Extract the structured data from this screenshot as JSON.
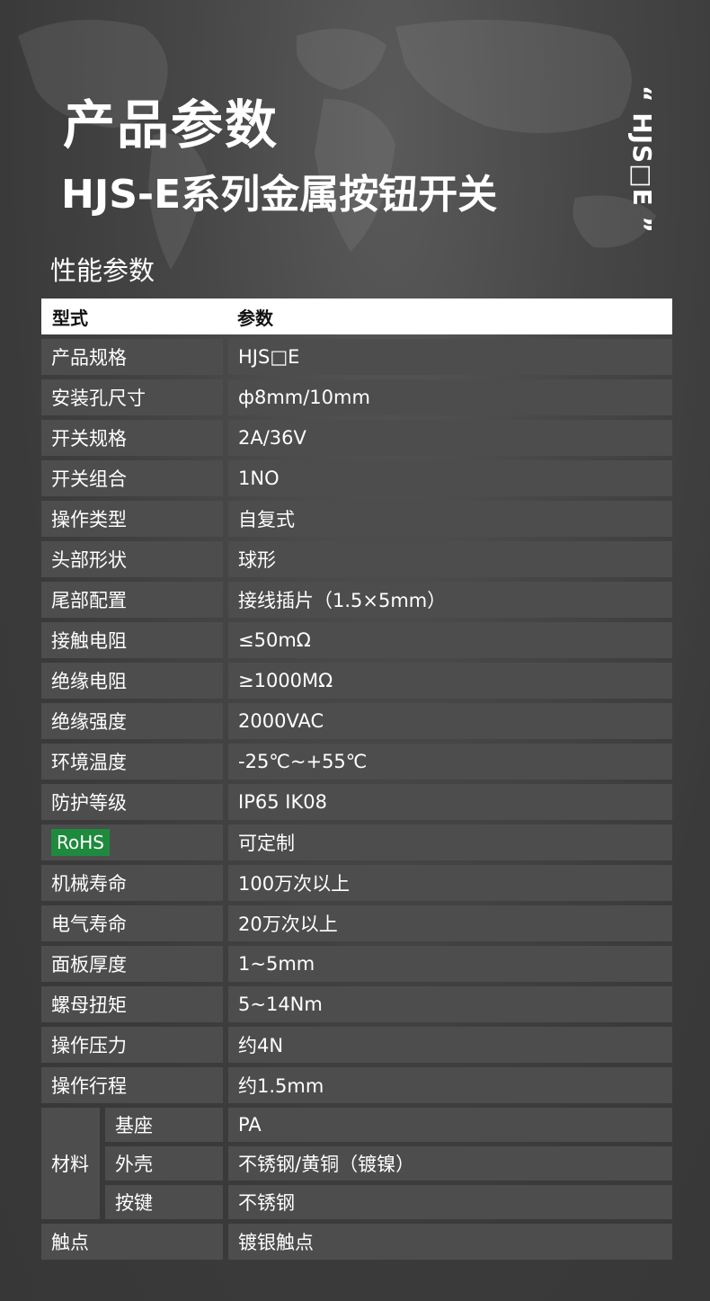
{
  "header": {
    "title": "产品参数",
    "subtitle": "HJS-E系列金属按钮开关",
    "vertical_model": "“ HJS□E ”"
  },
  "section": {
    "title": "性能参数"
  },
  "table": {
    "header": {
      "col1": "型式",
      "col2": "参数"
    },
    "rows": [
      {
        "key": "产品规格",
        "value": "HJS□E"
      },
      {
        "key": "安装孔尺寸",
        "value": "ф8mm/10mm"
      },
      {
        "key": "开关规格",
        "value": "2A/36V"
      },
      {
        "key": "开关组合",
        "value": "1NO"
      },
      {
        "key": "操作类型",
        "value": "自复式"
      },
      {
        "key": "头部形状",
        "value": "球形"
      },
      {
        "key": "尾部配置",
        "value": "接线插片（1.5×5mm）"
      },
      {
        "key": "接触电阻",
        "value": "≤50mΩ"
      },
      {
        "key": "绝缘电阻",
        "value": "≥1000MΩ"
      },
      {
        "key": "绝缘强度",
        "value": "2000VAC"
      },
      {
        "key": "环境温度",
        "value": "-25℃~+55℃"
      },
      {
        "key": "防护等级",
        "value": "IP65 IK08"
      },
      {
        "key": "RoHS",
        "value": "可定制"
      },
      {
        "key": "机械寿命",
        "value": "100万次以上"
      },
      {
        "key": "电气寿命",
        "value": "20万次以上"
      },
      {
        "key": "面板厚度",
        "value": "1~5mm"
      },
      {
        "key": "螺母扭矩",
        "value": "5~14Nm"
      },
      {
        "key": "操作压力",
        "value": "约4N"
      },
      {
        "key": "操作行程",
        "value": "约1.5mm"
      }
    ],
    "material": {
      "label": "材料",
      "items": [
        {
          "key": "基座",
          "value": "PA"
        },
        {
          "key": "外壳",
          "value": "不锈钢/黄铜（镀镍）"
        },
        {
          "key": "按键",
          "value": "不锈钢"
        }
      ]
    },
    "last_row": {
      "key": "触点",
      "value": "镀银触点"
    }
  },
  "colors": {
    "background": "#3a3a3a",
    "cell": "#4d4d4d",
    "header_row": "#ffffff",
    "rohs_badge": "#1e8a3d"
  }
}
